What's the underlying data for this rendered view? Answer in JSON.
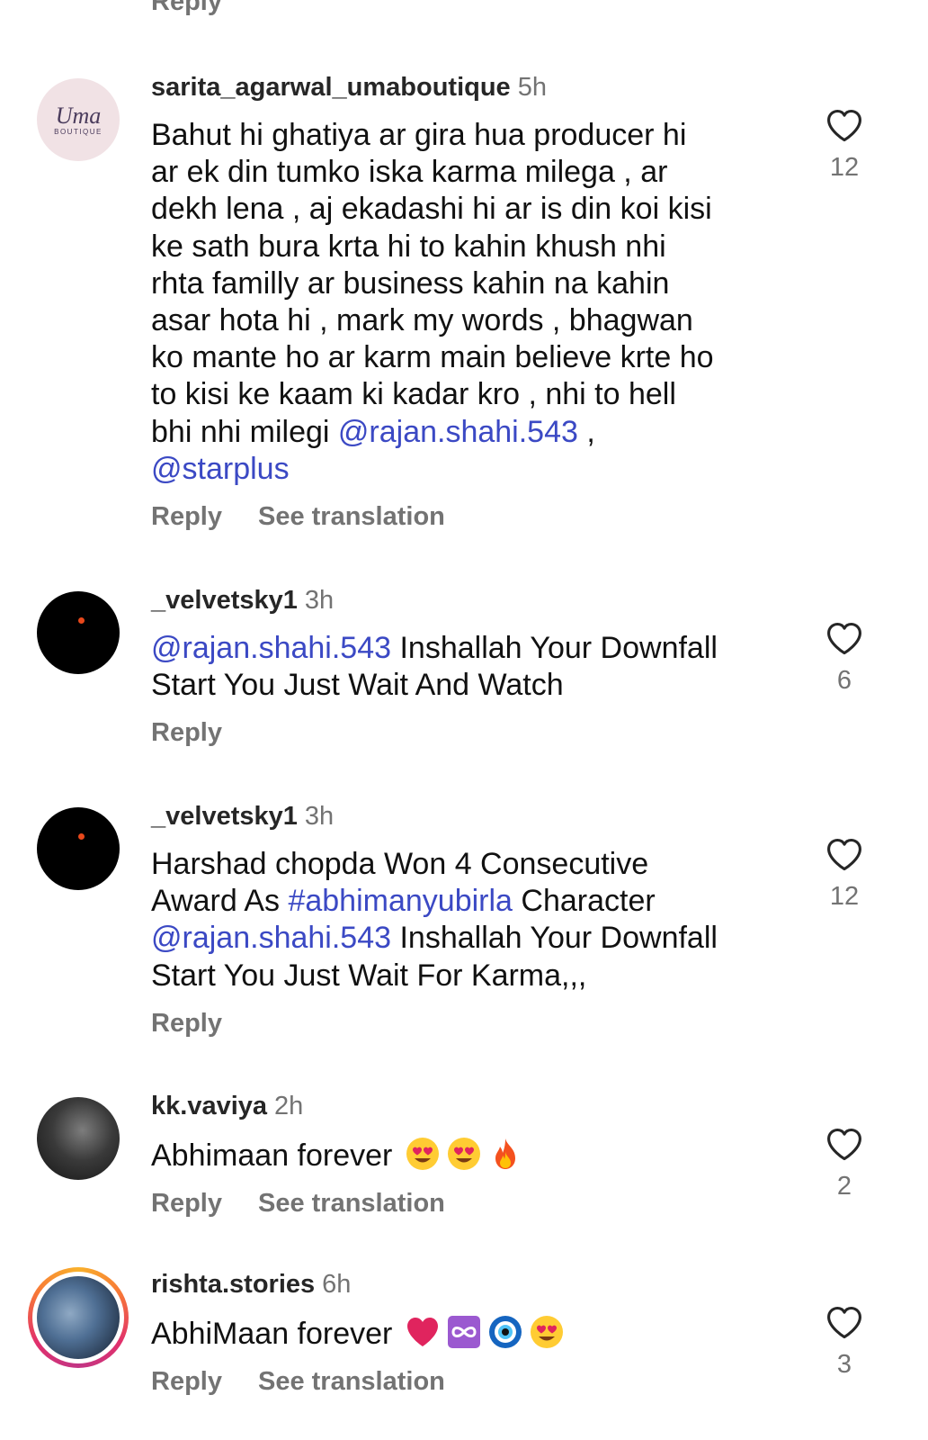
{
  "top_reply_label": "Reply",
  "comments": [
    {
      "username": "sarita_agarwal_umaboutique",
      "time": "5h",
      "avatar_text": "Uma",
      "avatar_subtext": "BOUTIQUE",
      "text_plain": "Bahut hi ghatiya ar gira hua producer hi\nar ek din tumko iska karma milega , ar\ndekh lena , aj ekadashi hi ar is din koi kisi\nke sath bura krta hi to kahin khush nhi\nrhta familly ar business kahin na kahin\nasar hota hi , mark my words , bhagwan\nko mante ho ar karm main believe krte ho\nto kisi ke kaam ki kadar kro , nhi to hell\nbhi nhi milegi ",
      "mention_1": "@rajan.shahi.543",
      "text_after_mention_1": " ,\n",
      "mention_2": "@starplus",
      "reply_label": "Reply",
      "translate_label": "See translation",
      "likes": "12"
    },
    {
      "username": "_velvetsky1",
      "time": "3h",
      "mention": "@rajan.shahi.543",
      "text": " Inshallah Your Downfall\nStart You Just Wait And Watch",
      "reply_label": "Reply",
      "likes": "6"
    },
    {
      "username": "_velvetsky1",
      "time": "3h",
      "text_1": "Harshad chopda Won 4 Consecutive\nAward As ",
      "hashtag": "#abhimanyubirla",
      "text_2": " Character\n",
      "mention": "@rajan.shahi.543",
      "text_3": " Inshallah Your Downfall\nStart You Just Wait For Karma,,,",
      "reply_label": "Reply",
      "likes": "12"
    },
    {
      "username": "kk.vaviya",
      "time": "2h",
      "text": "Abhimaan forever",
      "emojis": [
        "heart-eyes-emoji",
        "heart-eyes-emoji",
        "fire-emoji"
      ],
      "reply_label": "Reply",
      "translate_label": "See translation",
      "likes": "2"
    },
    {
      "username": "rishta.stories",
      "time": "6h",
      "text": "AbhiMaan forever",
      "emojis": [
        "red-heart-emoji",
        "infinity-emoji",
        "nazar-amulet-emoji",
        "heart-eyes-emoji"
      ],
      "reply_label": "Reply",
      "translate_label": "See translation",
      "likes": "3"
    }
  ],
  "colors": {
    "mention": "#3b49c4",
    "secondary_text": "#737373",
    "primary_text": "#111111"
  }
}
